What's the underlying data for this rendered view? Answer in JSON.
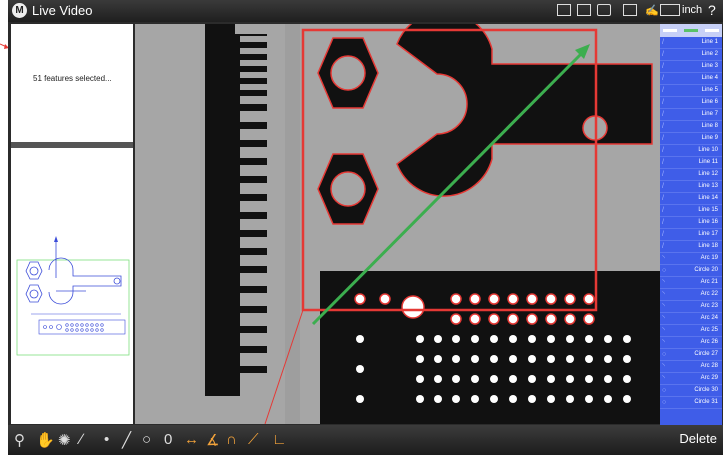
{
  "window": {
    "title": "Live Video",
    "logo": "M"
  },
  "toolbar": {
    "icons": [
      "home-icon",
      "camera-icon",
      "crosshair-icon",
      "grid-icon",
      "pen-icon",
      "ruler-icon"
    ],
    "unit": "inch",
    "help": "?"
  },
  "selection": {
    "text": "51 features selected..."
  },
  "features": [
    {
      "label": "Line 1",
      "icon": "/"
    },
    {
      "label": "Line 2",
      "icon": "/"
    },
    {
      "label": "Line 3",
      "icon": "/"
    },
    {
      "label": "Line 4",
      "icon": "/"
    },
    {
      "label": "Line 5",
      "icon": "/"
    },
    {
      "label": "Line 6",
      "icon": "/"
    },
    {
      "label": "Line 7",
      "icon": "/"
    },
    {
      "label": "Line 8",
      "icon": "/"
    },
    {
      "label": "Line 9",
      "icon": "/"
    },
    {
      "label": "Line 10",
      "icon": "/"
    },
    {
      "label": "Line 11",
      "icon": "/"
    },
    {
      "label": "Line 12",
      "icon": "/"
    },
    {
      "label": "Line 13",
      "icon": "/"
    },
    {
      "label": "Line 14",
      "icon": "/"
    },
    {
      "label": "Line 15",
      "icon": "/"
    },
    {
      "label": "Line 16",
      "icon": "/"
    },
    {
      "label": "Line 17",
      "icon": "/"
    },
    {
      "label": "Line 18",
      "icon": "/"
    },
    {
      "label": "Arc 19",
      "icon": "◝"
    },
    {
      "label": "Circle 20",
      "icon": "○"
    },
    {
      "label": "Arc 21",
      "icon": "◝"
    },
    {
      "label": "Arc 22",
      "icon": "◝"
    },
    {
      "label": "Arc 23",
      "icon": "◝"
    },
    {
      "label": "Arc 24",
      "icon": "◝"
    },
    {
      "label": "Arc 25",
      "icon": "◝"
    },
    {
      "label": "Arc 26",
      "icon": "◝"
    },
    {
      "label": "Circle 27",
      "icon": "○"
    },
    {
      "label": "Arc 28",
      "icon": "◝"
    },
    {
      "label": "Arc 29",
      "icon": "◝"
    },
    {
      "label": "Circle 30",
      "icon": "○"
    },
    {
      "label": "Circle 31",
      "icon": "○"
    }
  ],
  "bottom_tools": [
    {
      "name": "probe-icon",
      "glyph": "⚲",
      "accent": false
    },
    {
      "name": "hand-icon",
      "glyph": "✋",
      "accent": false
    },
    {
      "name": "light-icon",
      "glyph": "✺",
      "accent": false
    },
    {
      "name": "edge-tool-icon",
      "glyph": "∕",
      "accent": false
    },
    {
      "name": "point-tool-icon",
      "glyph": "•",
      "accent": false
    },
    {
      "name": "line-tool-icon",
      "glyph": "╱",
      "accent": false
    },
    {
      "name": "circle-tool-icon",
      "glyph": "○",
      "accent": false
    },
    {
      "name": "slot-tool-icon",
      "glyph": "0",
      "accent": false
    },
    {
      "name": "distance-tool-icon",
      "glyph": "↔",
      "accent": true
    },
    {
      "name": "angle-tool-icon",
      "glyph": "∡",
      "accent": true
    },
    {
      "name": "arc-tool-icon",
      "glyph": "∩",
      "accent": true
    },
    {
      "name": "construct-tool-icon",
      "glyph": "⟋",
      "accent": true
    },
    {
      "name": "datum-tool-icon",
      "glyph": "∟",
      "accent": true
    }
  ],
  "delete_label": "Delete",
  "colors": {
    "feature_panel": "#3f5de8",
    "highlight": "#e53935",
    "arrow": "#3cae4f"
  }
}
